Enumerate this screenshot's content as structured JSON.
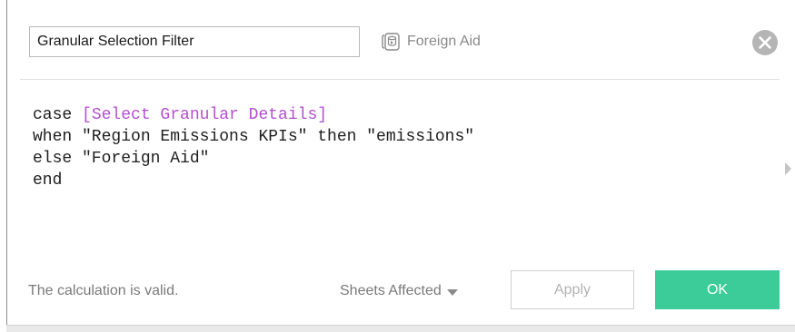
{
  "calc_name": {
    "value": "Granular Selection Filter"
  },
  "datasource": {
    "label": "Foreign Aid",
    "icon": "datasource-icon"
  },
  "close": {
    "icon": "close-circle-icon"
  },
  "editor": {
    "lines": [
      {
        "tokens": [
          {
            "text": "case ",
            "kind": "keyword"
          },
          {
            "text": "[Select Granular Details]",
            "kind": "field"
          }
        ]
      },
      {
        "tokens": [
          {
            "text": "when \"Region Emissions KPIs\" then \"emissions\"",
            "kind": "keyword"
          }
        ]
      },
      {
        "tokens": [
          {
            "text": "else \"Foreign Aid\"",
            "kind": "keyword"
          }
        ]
      },
      {
        "tokens": [
          {
            "text": "end",
            "kind": "keyword"
          }
        ]
      }
    ],
    "field_color": "#b44ed2",
    "text_color": "#1e1e1e"
  },
  "footer": {
    "status": "The calculation is valid.",
    "sheets_affected": "Sheets Affected",
    "apply_label": "Apply",
    "ok_label": "OK"
  },
  "colors": {
    "ok_button": "#3ccc99",
    "muted_text": "#7a7a7a"
  }
}
